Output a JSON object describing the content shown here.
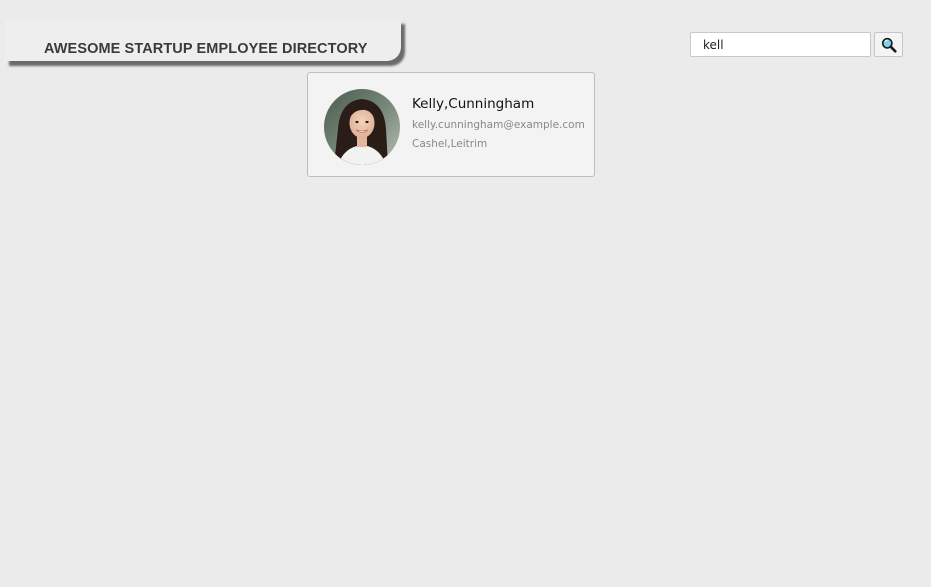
{
  "header": {
    "title": "AWESOME STARTUP EMPLOYEE DIRECTORY"
  },
  "search": {
    "value": "kell",
    "icon": "search-icon"
  },
  "employees": [
    {
      "name": "Kelly,Cunningham",
      "email": "kelly.cunningham@example.com",
      "location": "Cashel,Leitrim",
      "avatar_icon": "employee-photo"
    }
  ],
  "colors": {
    "background": "#ebebeb",
    "card_background": "#f3f3f3",
    "title_text": "#3a3a3a",
    "secondary_text": "#888888"
  }
}
